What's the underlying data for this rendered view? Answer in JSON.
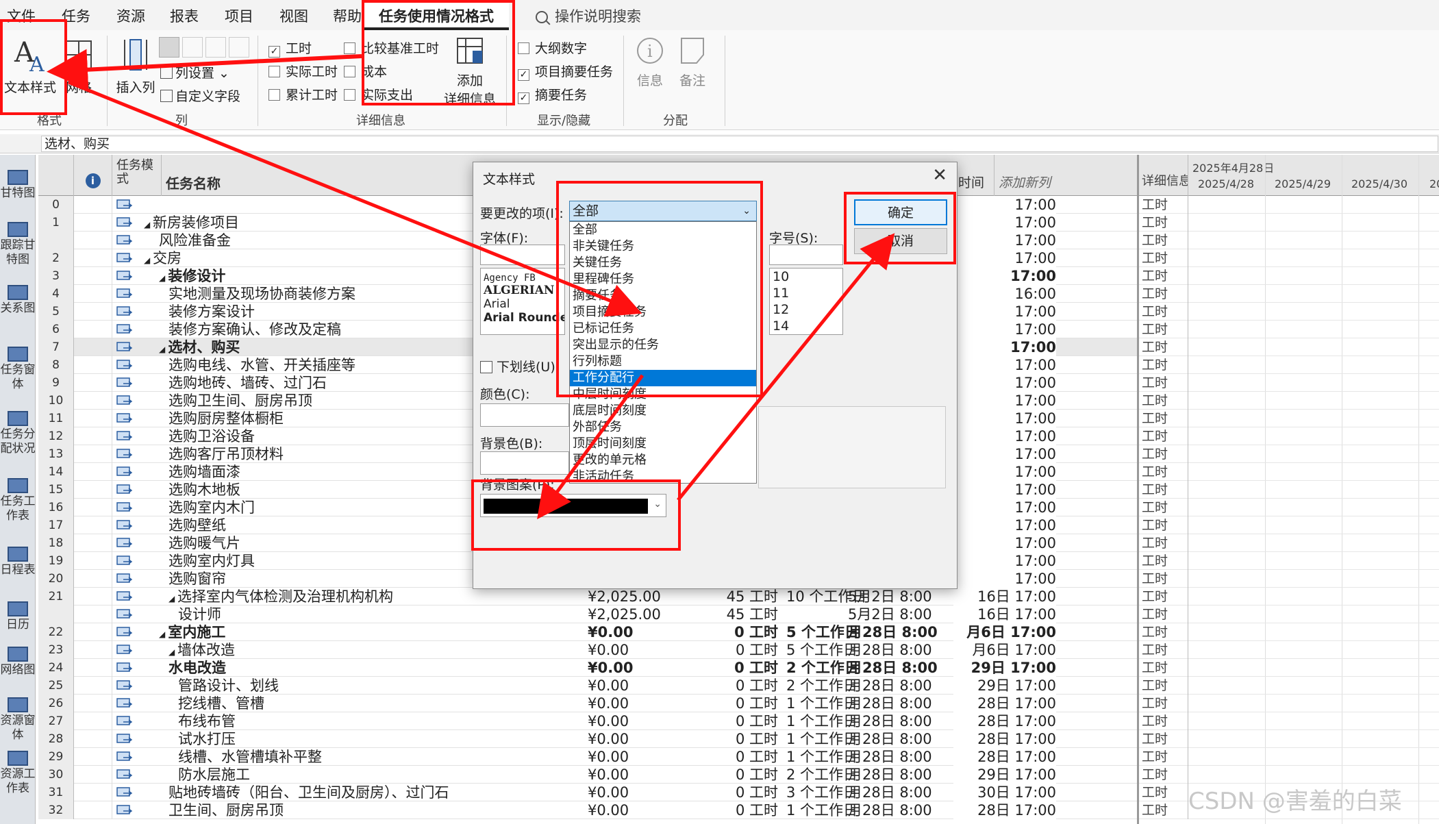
{
  "menu": {
    "items": [
      "文件",
      "任务",
      "资源",
      "报表",
      "项目",
      "视图",
      "帮助"
    ],
    "context_tab": "任务使用情况格式",
    "help_search": "操作说明搜索"
  },
  "ribbon": {
    "format_group": {
      "text_styles": "文本样式",
      "gridlines": "网格",
      "label": "格式"
    },
    "columns_group": {
      "insert_column": "插入列",
      "column_settings": "列设置",
      "custom_fields": "自定义字段",
      "label": "列"
    },
    "details_group": {
      "work": "工时",
      "actual_work": "实际工时",
      "cumulative_work": "累计工时",
      "baseline_work": "比较基准工时",
      "cost": "成本",
      "actual_cost": "实际支出",
      "add_details": "添加",
      "add_details2": "详细信息",
      "label": "详细信息"
    },
    "showhide_group": {
      "outline_number": "大纲数字",
      "project_summary": "项目摘要任务",
      "summary_tasks": "摘要任务",
      "label": "显示/隐藏"
    },
    "assign_group": {
      "info": "信息",
      "notes": "备注",
      "label": "分配"
    }
  },
  "formula_bar": {
    "value": "选材、购买"
  },
  "view_bar": [
    "甘特图",
    "跟踪甘特图",
    "关系图",
    "任务窗体",
    "任务分配状况",
    "任务工作表",
    "日程表",
    "日历",
    "网络图",
    "资源窗体",
    "资源工作表"
  ],
  "sheet": {
    "headers": {
      "task_mode": "任务模式",
      "task_name": "任务名称",
      "finish_partial": "时间",
      "add_column": "添加新列"
    },
    "rows": [
      {
        "n": "0",
        "name": "",
        "lvl": 0,
        "b": false,
        "fin": "17:00"
      },
      {
        "n": "1",
        "name": "新房装修项目",
        "lvl": 1,
        "b": false,
        "fin": "17:00"
      },
      {
        "n": "",
        "name": "风险准备金",
        "lvl": 2,
        "b": false,
        "fin": "17:00"
      },
      {
        "n": "2",
        "name": "交房",
        "lvl": 1,
        "b": false,
        "fin": "17:00"
      },
      {
        "n": "3",
        "name": "装修设计",
        "lvl": 2,
        "b": true,
        "fin": "17:00"
      },
      {
        "n": "4",
        "name": "实地测量及现场协商装修方案",
        "lvl": 3,
        "b": false,
        "fin": "16:00"
      },
      {
        "n": "5",
        "name": "装修方案设计",
        "lvl": 3,
        "b": false,
        "fin": "17:00"
      },
      {
        "n": "6",
        "name": "装修方案确认、修改及定稿",
        "lvl": 3,
        "b": false,
        "fin": "17:00"
      },
      {
        "n": "7",
        "name": "选材、购买",
        "lvl": 2,
        "b": true,
        "fin": "17:00"
      },
      {
        "n": "8",
        "name": "选购电线、水管、开关插座等",
        "lvl": 3,
        "b": false,
        "fin": "17:00"
      },
      {
        "n": "9",
        "name": "选购地砖、墙砖、过门石",
        "lvl": 3,
        "b": false,
        "fin": "17:00"
      },
      {
        "n": "10",
        "name": "选购卫生间、厨房吊顶",
        "lvl": 3,
        "b": false,
        "fin": "17:00"
      },
      {
        "n": "11",
        "name": "选购厨房整体橱柜",
        "lvl": 3,
        "b": false,
        "fin": "17:00"
      },
      {
        "n": "12",
        "name": "选购卫浴设备",
        "lvl": 3,
        "b": false,
        "fin": "17:00"
      },
      {
        "n": "13",
        "name": "选购客厅吊顶材料",
        "lvl": 3,
        "b": false,
        "fin": "17:00"
      },
      {
        "n": "14",
        "name": "选购墙面漆",
        "lvl": 3,
        "b": false,
        "fin": "17:00"
      },
      {
        "n": "15",
        "name": "选购木地板",
        "lvl": 3,
        "b": false,
        "fin": "17:00"
      },
      {
        "n": "16",
        "name": "选购室内木门",
        "lvl": 3,
        "b": false,
        "fin": "17:00"
      },
      {
        "n": "17",
        "name": "选购壁纸",
        "lvl": 3,
        "b": false,
        "fin": "17:00"
      },
      {
        "n": "18",
        "name": "选购暖气片",
        "lvl": 3,
        "b": false,
        "fin": "17:00"
      },
      {
        "n": "19",
        "name": "选购室内灯具",
        "lvl": 3,
        "b": false,
        "fin": "17:00"
      },
      {
        "n": "20",
        "name": "选购窗帘",
        "lvl": 3,
        "b": false,
        "fin": "17:00"
      },
      {
        "n": "21",
        "name": "选择室内气体检测及治理机构机构",
        "lvl": 3,
        "b": false,
        "cost": "¥2,025.00",
        "work": "45 工时",
        "dur": "10 个工作日",
        "start": "5月2日 8:00",
        "fin": "16日 17:00"
      },
      {
        "n": "",
        "name": "设计师",
        "lvl": 4,
        "b": false,
        "cost": "¥2,025.00",
        "work": "45 工时",
        "dur": "",
        "start": "5月2日 8:00",
        "fin": "16日 17:00"
      },
      {
        "n": "22",
        "name": "室内施工",
        "lvl": 2,
        "b": true,
        "cost": "¥0.00",
        "work": "0 工时",
        "dur": "5 个工作日",
        "start": "月28日 8:00",
        "fin": "月6日 17:00"
      },
      {
        "n": "23",
        "name": "墙体改造",
        "lvl": 3,
        "b": false,
        "cost": "¥0.00",
        "work": "0 工时",
        "dur": "5 个工作日",
        "start": "月28日 8:00",
        "fin": "月6日 17:00"
      },
      {
        "n": "24",
        "name": "水电改造",
        "lvl": 3,
        "b": true,
        "cost": "¥0.00",
        "work": "0 工时",
        "dur": "2 个工作日",
        "start": "月28日 8:00",
        "fin": "29日 17:00"
      },
      {
        "n": "25",
        "name": "管路设计、划线",
        "lvl": 4,
        "b": false,
        "cost": "¥0.00",
        "work": "0 工时",
        "dur": "2 个工作日",
        "start": "月28日 8:00",
        "fin": "29日 17:00"
      },
      {
        "n": "26",
        "name": "挖线槽、管槽",
        "lvl": 4,
        "b": false,
        "cost": "¥0.00",
        "work": "0 工时",
        "dur": "1 个工作日",
        "start": "月28日 8:00",
        "fin": "28日 17:00"
      },
      {
        "n": "27",
        "name": "布线布管",
        "lvl": 4,
        "b": false,
        "cost": "¥0.00",
        "work": "0 工时",
        "dur": "1 个工作日",
        "start": "月28日 8:00",
        "fin": "28日 17:00"
      },
      {
        "n": "28",
        "name": "试水打压",
        "lvl": 4,
        "b": false,
        "cost": "¥0.00",
        "work": "0 工时",
        "dur": "1 个工作日",
        "start": "月28日 8:00",
        "fin": "28日 17:00"
      },
      {
        "n": "29",
        "name": "线槽、水管槽填补平整",
        "lvl": 4,
        "b": false,
        "cost": "¥0.00",
        "work": "0 工时",
        "dur": "1 个工作日",
        "start": "月28日 8:00",
        "fin": "28日 17:00"
      },
      {
        "n": "30",
        "name": "防水层施工",
        "lvl": 4,
        "b": false,
        "cost": "¥0.00",
        "work": "0 工时",
        "dur": "2 个工作日",
        "start": "月28日 8:00",
        "fin": "29日 17:00"
      },
      {
        "n": "31",
        "name": "贴地砖墙砖（阳台、卫生间及厨房）、过门石",
        "lvl": 3,
        "b": false,
        "cost": "¥0.00",
        "work": "0 工时",
        "dur": "3 个工作日",
        "start": "月28日 8:00",
        "fin": "30日 17:00"
      },
      {
        "n": "32",
        "name": "卫生间、厨房吊顶",
        "lvl": 3,
        "b": false,
        "cost": "¥0.00",
        "work": "0 工时",
        "dur": "1 个工作日",
        "start": "月28日 8:00",
        "fin": "28日 17:00"
      }
    ]
  },
  "detail_grid": {
    "label_header": "详细信息",
    "week_label": "2025年4月28日",
    "dates": [
      "2025/4/28",
      "2025/4/29",
      "2025/4/30",
      "20"
    ],
    "row_label": "工时"
  },
  "dialog": {
    "title": "文本样式",
    "item_label": "要更改的项(I):",
    "item_value": "全部",
    "items": [
      "全部",
      "非关键任务",
      "关键任务",
      "里程碑任务",
      "摘要任务",
      "项目摘要任务",
      "已标记任务",
      "突出显示的任务",
      "行列标题",
      "工作分配行",
      "中层时间刻度",
      "底层时间刻度",
      "外部任务",
      "顶层时间刻度",
      "更改的单元格",
      "非活动任务"
    ],
    "selected_item": "工作分配行",
    "font_label": "字体(F):",
    "fonts": [
      "Agency FB",
      "ALGERIAN",
      "Arial",
      "Arial Rounded"
    ],
    "size_label": "字号(S):",
    "sizes": [
      "10",
      "11",
      "12",
      "14"
    ],
    "underline_label": "下划线(U)",
    "color_label": "颜色(C):",
    "background_label": "背景色(B):",
    "pattern_label": "背景图案(P):",
    "ok": "确定",
    "cancel": "取消"
  },
  "watermark": "CSDN @害羞的白菜"
}
